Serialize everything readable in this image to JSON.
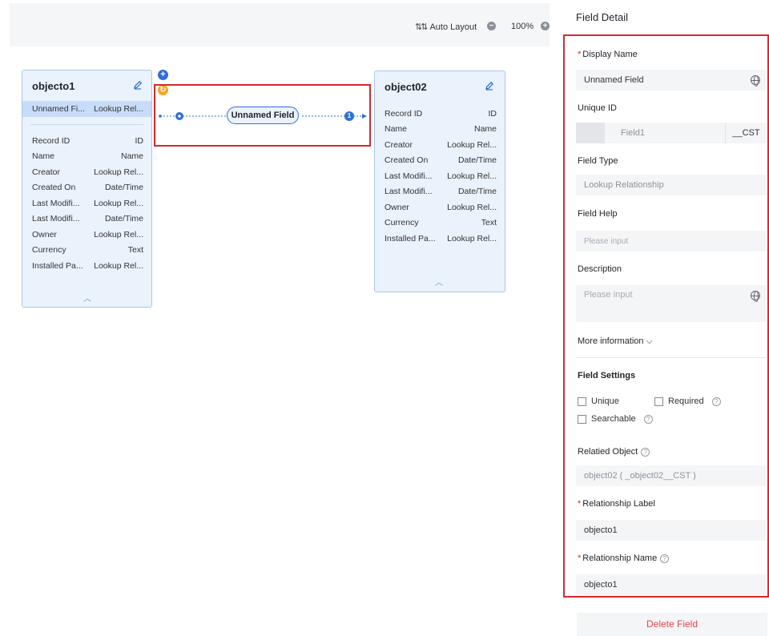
{
  "toolbar": {
    "auto_layout_label": "Auto Layout",
    "zoom_out_glyph": "−",
    "zoom_label": "100%",
    "zoom_in_glyph": "+"
  },
  "canvas": {
    "add_glyph": "+",
    "swap_glyph": "↻",
    "relationship_label": "Unnamed Field",
    "end_marker": "1"
  },
  "object1": {
    "title": "objecto1",
    "new_field": {
      "name": "Unnamed Fi...",
      "type": "Lookup Rel..."
    },
    "fields": [
      {
        "name": "Record ID",
        "type": "ID"
      },
      {
        "name": "Name",
        "type": "Name"
      },
      {
        "name": "Creator",
        "type": "Lookup Rel..."
      },
      {
        "name": "Created On",
        "type": "Date/Time"
      },
      {
        "name": "Last Modifi...",
        "type": "Lookup Rel..."
      },
      {
        "name": "Last Modifi...",
        "type": "Date/Time"
      },
      {
        "name": "Owner",
        "type": "Lookup Rel..."
      },
      {
        "name": "Currency",
        "type": "Text"
      },
      {
        "name": "Installed Pa...",
        "type": "Lookup Rel..."
      }
    ]
  },
  "object2": {
    "title": "object02",
    "fields": [
      {
        "name": "Record ID",
        "type": "ID"
      },
      {
        "name": "Name",
        "type": "Name"
      },
      {
        "name": "Creator",
        "type": "Lookup Rel..."
      },
      {
        "name": "Created On",
        "type": "Date/Time"
      },
      {
        "name": "Last Modifi...",
        "type": "Lookup Rel..."
      },
      {
        "name": "Last Modifi...",
        "type": "Date/Time"
      },
      {
        "name": "Owner",
        "type": "Lookup Rel..."
      },
      {
        "name": "Currency",
        "type": "Text"
      },
      {
        "name": "Installed Pa...",
        "type": "Lookup Rel..."
      }
    ]
  },
  "panel": {
    "title": "Field Detail",
    "display_name_label": "Display Name",
    "display_name_value": "Unnamed Field",
    "unique_id_label": "Unique ID",
    "unique_id_value": "Field1",
    "unique_id_suffix": "__CST",
    "field_type_label": "Field Type",
    "field_type_value": "Lookup Relationship",
    "field_help_label": "Field Help",
    "field_help_placeholder": "Please input",
    "description_label": "Description",
    "description_placeholder": "Please input",
    "more_info_label": "More information",
    "field_settings_label": "Field Settings",
    "unique_label": "Unique",
    "required_label": "Required",
    "searchable_label": "Searchable",
    "related_object_label": "Relatied Object",
    "related_object_value": "object02 (      _object02__CST )",
    "relationship_label_label": "Relationship Label",
    "relationship_label_value": "objecto1",
    "relationship_name_label": "Relationship Name",
    "relationship_name_value": "objecto1",
    "required_mark": "*",
    "help_glyph": "?",
    "delete_label": "Delete Field"
  },
  "colors": {
    "accent": "#2f6fd6",
    "danger": "#d9262f",
    "card_bg": "#eaf2fc",
    "swap": "#f5a623"
  }
}
